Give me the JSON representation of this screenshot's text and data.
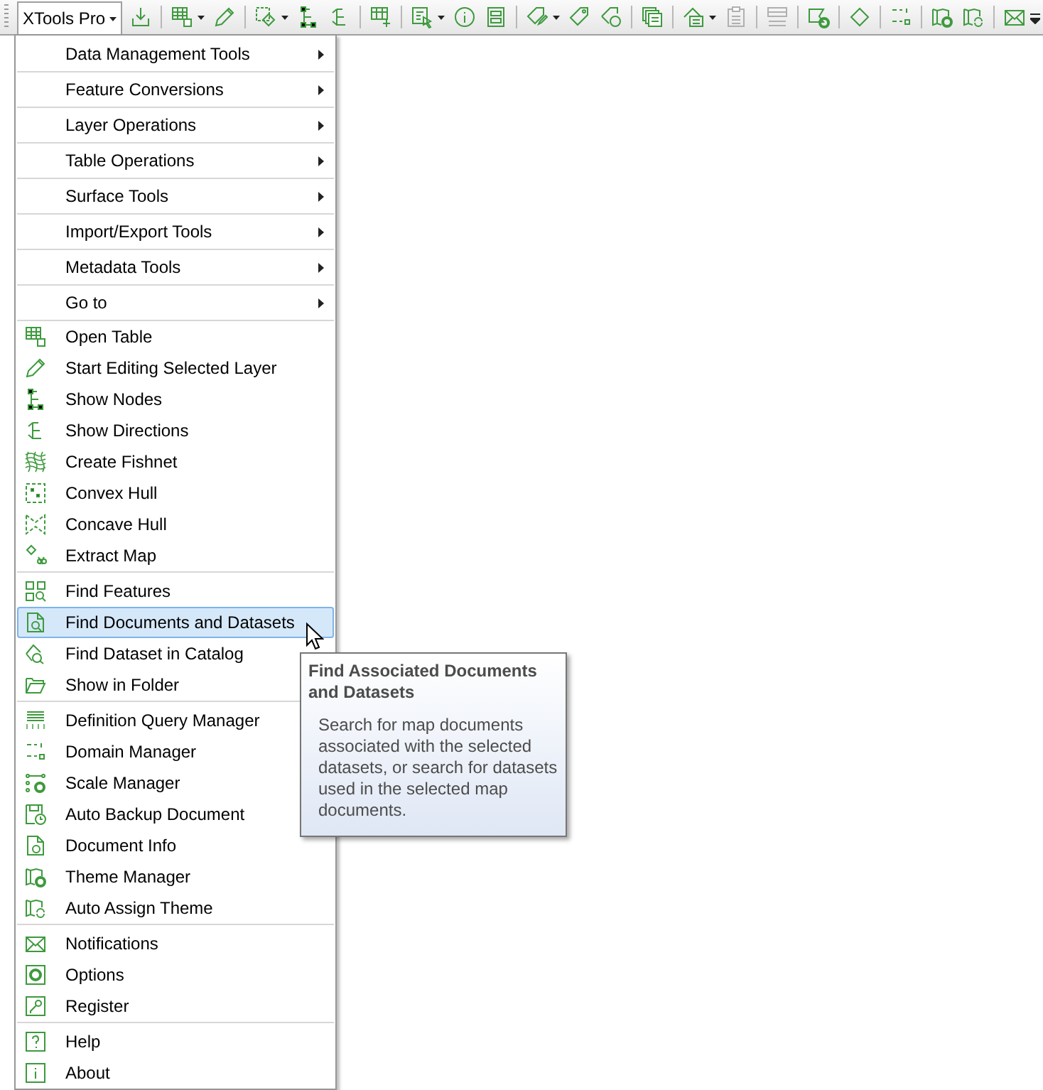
{
  "toolbar": {
    "menu_button": {
      "label": "XTools Pro",
      "pressed": true
    },
    "items": [
      {
        "kind": "button",
        "disabled": false
      },
      {
        "kind": "separator"
      },
      {
        "kind": "split",
        "disabled": false
      },
      {
        "kind": "button",
        "disabled": false
      },
      {
        "kind": "separator"
      },
      {
        "kind": "split",
        "disabled": false
      },
      {
        "kind": "button",
        "disabled": false
      },
      {
        "kind": "button",
        "disabled": false
      },
      {
        "kind": "separator"
      },
      {
        "kind": "button",
        "disabled": false
      },
      {
        "kind": "separator"
      },
      {
        "kind": "split",
        "disabled": false
      },
      {
        "kind": "button",
        "disabled": false
      },
      {
        "kind": "button",
        "disabled": false
      },
      {
        "kind": "separator"
      },
      {
        "kind": "split",
        "disabled": false
      },
      {
        "kind": "button",
        "disabled": false
      },
      {
        "kind": "button",
        "disabled": false
      },
      {
        "kind": "separator"
      },
      {
        "kind": "button",
        "disabled": false
      },
      {
        "kind": "separator"
      },
      {
        "kind": "split",
        "disabled": false
      },
      {
        "kind": "button",
        "disabled": true
      },
      {
        "kind": "separator"
      },
      {
        "kind": "button",
        "disabled": true
      },
      {
        "kind": "separator"
      },
      {
        "kind": "button",
        "disabled": false
      },
      {
        "kind": "separator"
      },
      {
        "kind": "button",
        "disabled": false
      },
      {
        "kind": "separator"
      },
      {
        "kind": "button",
        "disabled": false
      },
      {
        "kind": "separator"
      },
      {
        "kind": "button",
        "disabled": false
      },
      {
        "kind": "button",
        "disabled": false
      },
      {
        "kind": "separator"
      },
      {
        "kind": "button",
        "disabled": false
      }
    ]
  },
  "menu": {
    "sections": [
      {
        "items": [
          {
            "label": "Data Management Tools",
            "kind": "submenu",
            "selected": false
          }
        ]
      },
      {
        "items": [
          {
            "label": "Feature Conversions",
            "kind": "submenu",
            "selected": false
          }
        ]
      },
      {
        "items": [
          {
            "label": "Layer Operations",
            "kind": "submenu",
            "selected": false
          }
        ]
      },
      {
        "items": [
          {
            "label": "Table Operations",
            "kind": "submenu",
            "selected": false
          }
        ]
      },
      {
        "items": [
          {
            "label": "Surface Tools",
            "kind": "submenu",
            "selected": false
          }
        ]
      },
      {
        "items": [
          {
            "label": "Import/Export Tools",
            "kind": "submenu",
            "selected": false
          }
        ]
      },
      {
        "items": [
          {
            "label": "Metadata Tools",
            "kind": "submenu",
            "selected": false
          }
        ]
      },
      {
        "items": [
          {
            "label": "Go to",
            "kind": "submenu",
            "selected": false
          }
        ]
      },
      {
        "items": [
          {
            "label": "Open Table",
            "kind": "command",
            "selected": false
          },
          {
            "label": "Start Editing Selected Layer",
            "kind": "command",
            "selected": false
          },
          {
            "label": "Show Nodes",
            "kind": "command",
            "selected": false
          },
          {
            "label": "Show Directions",
            "kind": "command",
            "selected": false
          },
          {
            "label": "Create Fishnet",
            "kind": "command",
            "selected": false
          },
          {
            "label": "Convex Hull",
            "kind": "command",
            "selected": false
          },
          {
            "label": "Concave Hull",
            "kind": "command",
            "selected": false
          },
          {
            "label": "Extract Map",
            "kind": "command",
            "selected": false
          }
        ]
      },
      {
        "items": [
          {
            "label": "Find Features",
            "kind": "command",
            "selected": false
          },
          {
            "label": "Find Documents and Datasets",
            "kind": "command",
            "selected": true
          },
          {
            "label": "Find Dataset in Catalog",
            "kind": "command",
            "selected": false
          },
          {
            "label": "Show in Folder",
            "kind": "command",
            "selected": false
          }
        ]
      },
      {
        "items": [
          {
            "label": "Definition Query Manager",
            "kind": "command",
            "selected": false
          },
          {
            "label": "Domain Manager",
            "kind": "command",
            "selected": false
          },
          {
            "label": "Scale Manager",
            "kind": "command",
            "selected": false
          },
          {
            "label": "Auto Backup Document",
            "kind": "command",
            "selected": false
          },
          {
            "label": "Document Info",
            "kind": "command",
            "selected": false
          },
          {
            "label": "Theme Manager",
            "kind": "command",
            "selected": false
          },
          {
            "label": "Auto Assign Theme",
            "kind": "command",
            "selected": false
          }
        ]
      },
      {
        "items": [
          {
            "label": "Notifications",
            "kind": "command",
            "selected": false
          },
          {
            "label": "Options",
            "kind": "command",
            "selected": false
          },
          {
            "label": "Register",
            "kind": "command",
            "selected": false
          }
        ]
      },
      {
        "items": [
          {
            "label": "Help",
            "kind": "command",
            "selected": false
          },
          {
            "label": "About",
            "kind": "command",
            "selected": false
          }
        ]
      }
    ]
  },
  "tooltip": {
    "title": "Find Associated Documents and Datasets",
    "body": "Search for map documents associated with the selected datasets, or search for datasets used in the selected map documents."
  }
}
